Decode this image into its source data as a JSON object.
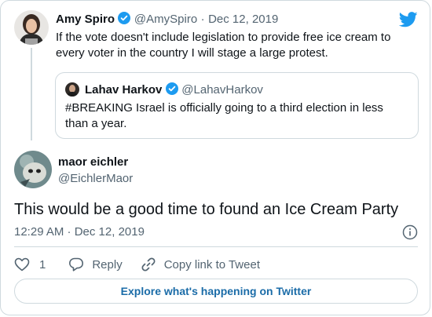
{
  "parent_tweet": {
    "author_name": "Amy Spiro",
    "author_handle": "@AmySpiro",
    "separator": "·",
    "date": "Dec 12, 2019",
    "text_line1": "If the vote doesn't include legislation to provide free ice cream to",
    "text_line2": "every voter in the country I will stage a large protest."
  },
  "quoted_tweet": {
    "author_name": "Lahav Harkov",
    "author_handle": "@LahavHarkov",
    "text_line1": "#BREAKING Israel is officially going to a third election in less",
    "text_line2": "than a year."
  },
  "main_tweet": {
    "author_name": "maor eichler",
    "author_handle": "@EichlerMaor",
    "text": "This would be a good time to found an Ice Cream Party",
    "timestamp": "12:29 AM · Dec 12, 2019"
  },
  "actions": {
    "like_count": "1",
    "reply_label": "Reply",
    "copy_link_label": "Copy link to Tweet"
  },
  "footer": {
    "explore_label": "Explore what's happening on Twitter"
  },
  "colors": {
    "brand_blue": "#1d9bf0",
    "link_blue": "#1b6ca8",
    "secondary_text": "#536471",
    "border": "#cfd9de"
  },
  "icons": [
    "twitter-bird-icon",
    "verified-badge-icon",
    "heart-icon",
    "reply-icon",
    "link-icon",
    "info-icon"
  ]
}
